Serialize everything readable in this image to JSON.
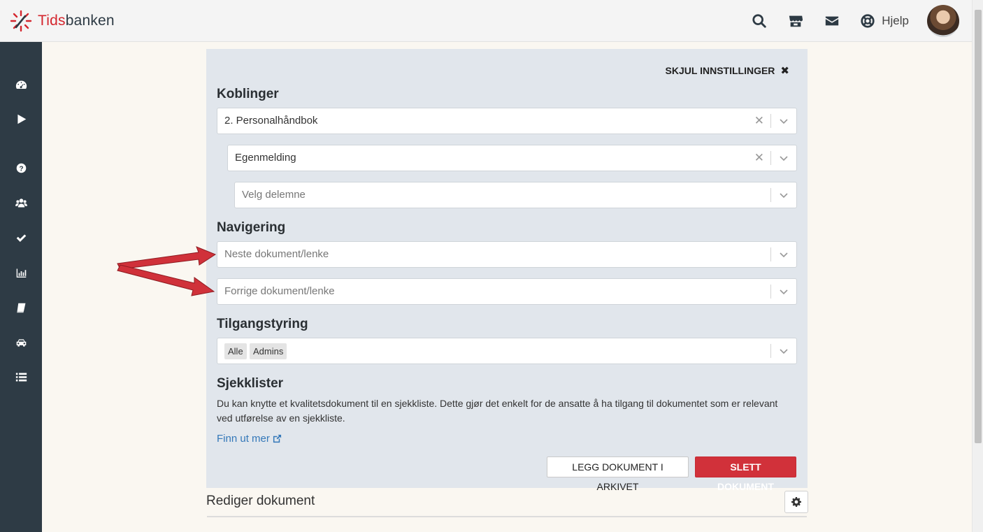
{
  "header": {
    "logo_text_a": "Tids",
    "logo_text_b": "banken",
    "icons": [
      "search-icon",
      "store-icon",
      "mail-icon",
      "lifebuoy-icon"
    ],
    "help_label": "Hjelp"
  },
  "sidebar": {
    "items": [
      {
        "icon": "dashboard-icon"
      },
      {
        "icon": "play-icon"
      },
      {
        "icon": "question-icon"
      },
      {
        "icon": "users-icon"
      },
      {
        "icon": "check-icon"
      },
      {
        "icon": "bar-chart-icon"
      },
      {
        "icon": "book-icon"
      },
      {
        "icon": "car-icon"
      },
      {
        "icon": "list-icon"
      }
    ]
  },
  "settings": {
    "hide_label": "SKJUL INNSTILLINGER",
    "hide_icon": "✖",
    "koblinger": {
      "title": "Koblinger",
      "select1_value": "2. Personalhåndbok",
      "select2_value": "Egenmelding",
      "select3_placeholder": "Velg delemne"
    },
    "navigering": {
      "title": "Navigering",
      "next_placeholder": "Neste dokument/lenke",
      "prev_placeholder": "Forrige dokument/lenke"
    },
    "tilgangsstyring": {
      "title": "Tilgangstyring",
      "tags": [
        "Alle",
        "Admins"
      ]
    },
    "sjekklister": {
      "title": "Sjekklister",
      "description": "Du kan knytte et kvalitetsdokument til en sjekkliste. Dette gjør det enkelt for de ansatte å ha tilgang til dokumentet som er relevant ved utførelse av en sjekkliste.",
      "link_label": "Finn ut mer"
    },
    "archive_button": "LEGG DOKUMENT I ARKIVET",
    "delete_button": "SLETT DOKUMENT"
  },
  "editor": {
    "title": "Rediger dokument"
  },
  "colors": {
    "brand_red": "#d4262e",
    "sidebar_bg": "#2e3b45",
    "panel_bg": "#e1e6ec",
    "delete_red": "#d1313a",
    "link_blue": "#3478b9",
    "arrow_red": "#d0313a"
  }
}
